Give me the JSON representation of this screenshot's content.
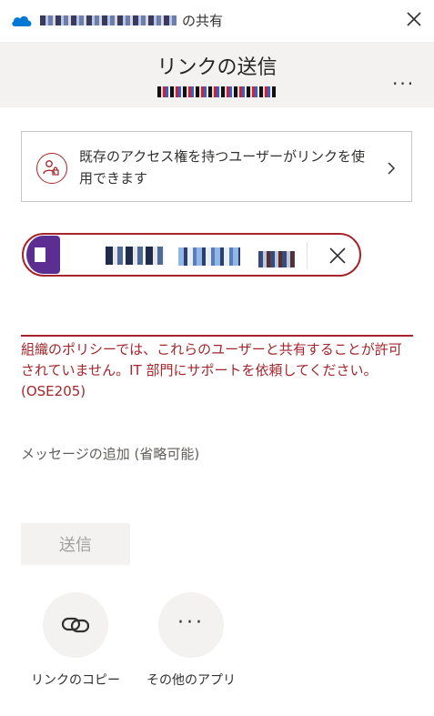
{
  "window": {
    "title_suffix": "の共有",
    "close_icon": "close-icon"
  },
  "header": {
    "title": "リンクの送信",
    "more_label": "..."
  },
  "access": {
    "text": "既存のアクセス権を持つユーザーがリンクを使用できます",
    "icon": "people-lock-icon"
  },
  "recipients": {
    "remove_icon": "close-icon"
  },
  "error": {
    "text": "組織のポリシーでは、これらのユーザーと共有することが許可されていません。IT 部門にサポートを依頼してください。(OSE205)"
  },
  "message": {
    "placeholder": "メッセージの追加 (省略可能)",
    "value": ""
  },
  "send": {
    "label": "送信"
  },
  "actions": {
    "copy_link": {
      "label": "リンクのコピー",
      "icon": "link-icon"
    },
    "other_apps": {
      "label": "その他のアプリ",
      "icon": "more-icon",
      "glyph": "···"
    }
  },
  "colors": {
    "error": "#a4262c",
    "avatar": "#5c2e91",
    "onedrive": "#0078d4"
  }
}
